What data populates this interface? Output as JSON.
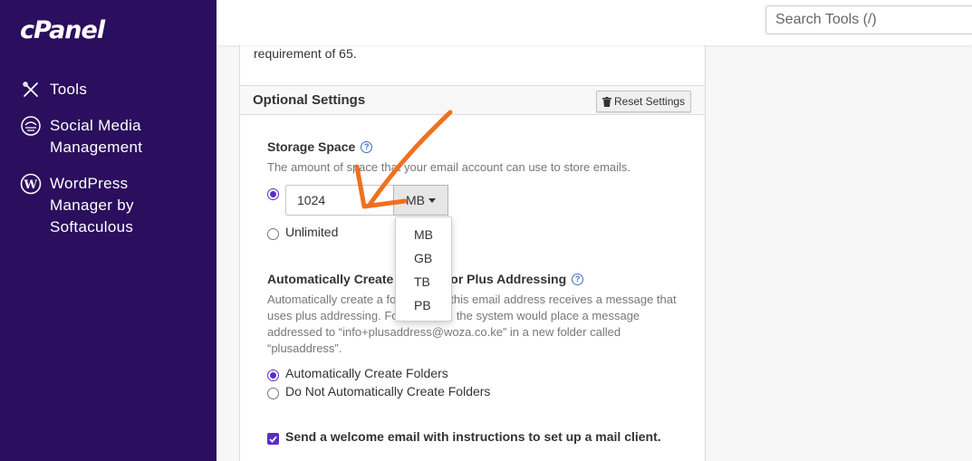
{
  "sidebar": {
    "logo": "cPanel",
    "items": [
      {
        "label": "Tools",
        "icon": "tools-icon"
      },
      {
        "label": "Social Media Management",
        "icon": "social-media-icon"
      },
      {
        "label": "WordPress Manager by Softaculous",
        "icon": "wordpress-icon"
      }
    ]
  },
  "topbar": {
    "search_placeholder": "Search Tools (/)"
  },
  "form": {
    "requirement_text": "requirement of 65.",
    "optional_settings": {
      "title": "Optional Settings",
      "reset_label": "Reset Settings"
    },
    "storage": {
      "label": "Storage Space",
      "description": "The amount of space that your email account can use to store emails.",
      "quota_value": "1024",
      "unit_selected": "MB",
      "unit_options": [
        "MB",
        "GB",
        "TB",
        "PB"
      ],
      "unlimited_label": "Unlimited",
      "limited_selected": true
    },
    "plus_addressing": {
      "label": "Automatically Create Folders for Plus Addressing",
      "description": "Automatically create a folder when this email address receives a message that uses plus addressing. For example, the system would place a message addressed to “info+plusaddress@woza.co.ke” in a new folder called “plusaddress”.",
      "option_auto": "Automatically Create Folders",
      "option_no_auto": "Do Not Automatically Create Folders"
    },
    "welcome_email": {
      "label": "Send a welcome email with instructions to set up a mail client.",
      "checked": true
    }
  },
  "colors": {
    "sidebar_bg": "#2b0f5e",
    "accent": "#5a2ec7",
    "annotation_arrow": "#f07020"
  }
}
